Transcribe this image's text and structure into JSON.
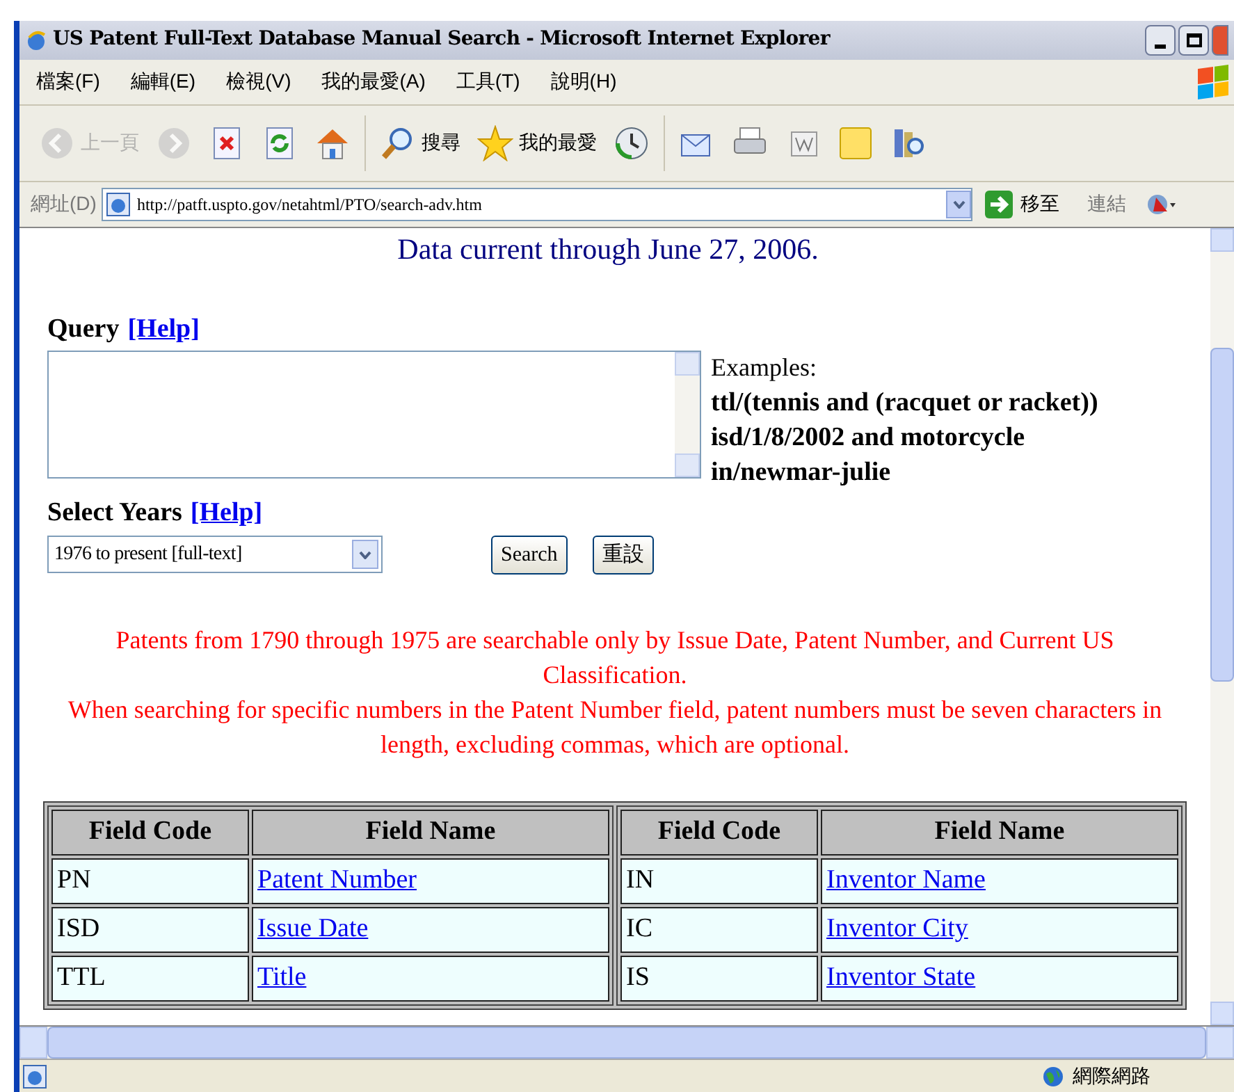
{
  "window": {
    "title": "US Patent Full-Text Database Manual Search - Microsoft Internet Explorer"
  },
  "menu": [
    "檔案(F)",
    "編輯(E)",
    "檢視(V)",
    "我的最愛(A)",
    "工具(T)",
    "說明(H)"
  ],
  "toolbar": [
    {
      "kind": "back",
      "label": "上一頁",
      "disabled": true
    },
    {
      "kind": "forward",
      "disabled": true
    },
    {
      "kind": "stop"
    },
    {
      "kind": "refresh"
    },
    {
      "kind": "home"
    },
    {
      "kind": "search",
      "label": "搜尋"
    },
    {
      "kind": "favorites",
      "label": "我的最愛"
    },
    {
      "kind": "history"
    },
    {
      "kind": "mail"
    },
    {
      "kind": "print"
    },
    {
      "kind": "edit"
    },
    {
      "kind": "note"
    },
    {
      "kind": "research"
    }
  ],
  "address_bar": {
    "label": "網址(D)",
    "url": "http://patft.uspto.gov/netahtml/PTO/search-adv.htm",
    "go": "移至",
    "links": "連結"
  },
  "page": {
    "heading": "Data current through June 27, 2006.",
    "query_label": "Query",
    "query_help": "[Help]",
    "examples": {
      "label": "Examples:",
      "lines": [
        "ttl/(tennis and (racquet or racket))",
        "isd/1/8/2002 and motorcycle",
        "in/newmar-julie"
      ]
    },
    "years_label": "Select Years",
    "years_help": "[Help]",
    "years_value": "1976 to present [full-text]",
    "buttons": [
      "Search",
      "重設"
    ],
    "notes": [
      "Patents from 1790 through 1975 are searchable only by Issue Date, Patent Number, and Current US Classification.",
      "When searching for specific numbers in the Patent Number field, patent numbers must be seven characters in length, excluding commas, which are optional."
    ],
    "tables": [
      {
        "columns": [
          "Field Code",
          "Field Name"
        ],
        "rows": [
          [
            "PN",
            "Patent Number"
          ],
          [
            "ISD",
            "Issue Date"
          ],
          [
            "TTL",
            "Title"
          ]
        ]
      },
      {
        "columns": [
          "Field Code",
          "Field Name"
        ],
        "rows": [
          [
            "IN",
            "Inventor Name"
          ],
          [
            "IC",
            "Inventor City"
          ],
          [
            "IS",
            "Inventor State"
          ]
        ]
      }
    ]
  },
  "status_bar": {
    "zone": "網際網路"
  }
}
